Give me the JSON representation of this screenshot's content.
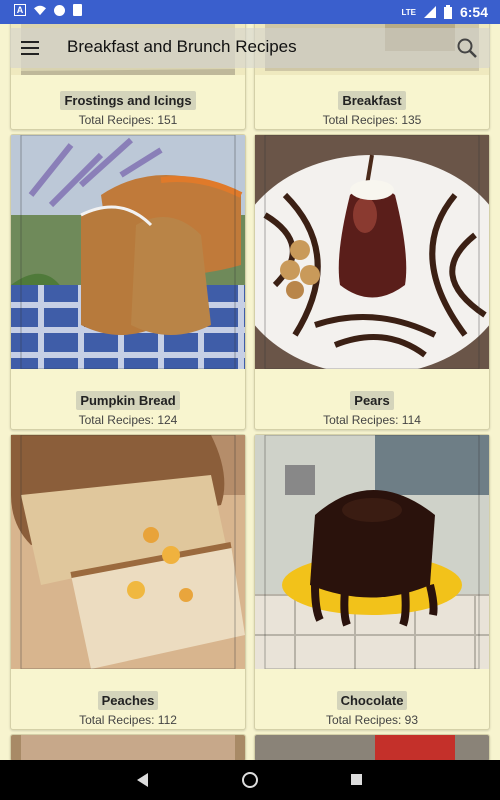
{
  "status_bar": {
    "lte": "LTE",
    "time": "6:54",
    "colors": {
      "background": "#3a5fcd"
    }
  },
  "toolbar": {
    "title": "Breakfast and Brunch Recipes",
    "menu_icon": "hamburger-menu-icon",
    "search_icon": "search-icon"
  },
  "categories": [
    {
      "name": "Frostings and Icings",
      "count": "Total Recipes: 151"
    },
    {
      "name": "Breakfast",
      "count": "Total Recipes: 135"
    },
    {
      "name": "Pumpkin Bread",
      "count": "Total Recipes: 124"
    },
    {
      "name": "Pears",
      "count": "Total Recipes: 114"
    },
    {
      "name": "Peaches",
      "count": "Total Recipes: 112"
    },
    {
      "name": "Chocolate",
      "count": "Total Recipes: 93"
    }
  ],
  "colors": {
    "app_background": "#f7f4cf"
  }
}
